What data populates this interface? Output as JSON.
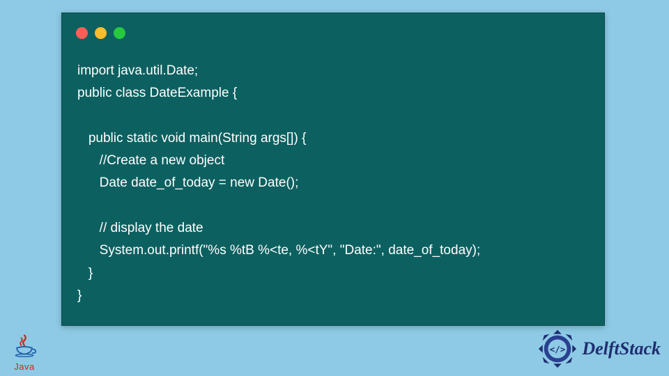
{
  "code": {
    "lines": [
      "import java.util.Date;",
      "public class DateExample {",
      "",
      "   public static void main(String args[]) {",
      "      //Create a new object",
      "      Date date_of_today = new Date();",
      "",
      "      // display the date",
      "      System.out.printf(\"%s %tB %<te, %<tY\", \"Date:\", date_of_today);",
      "   }",
      "}"
    ]
  },
  "logos": {
    "java_label": "Java",
    "delft_label": "DelftStack"
  },
  "colors": {
    "background": "#8ecae6",
    "window": "#0d6060",
    "red": "#ff5f56",
    "yellow": "#ffbd2e",
    "green": "#27c93f",
    "java_red": "#c42b1c",
    "delft_blue": "#1e2f6f"
  }
}
